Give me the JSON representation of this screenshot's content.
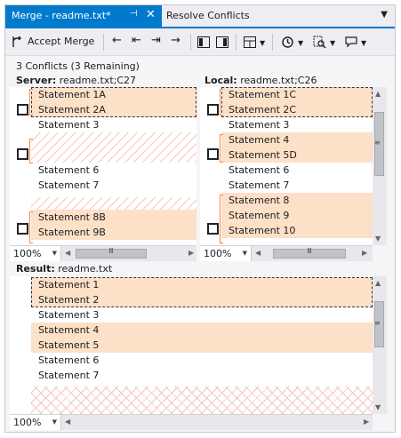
{
  "tabs": {
    "active": "Merge - readme.txt*",
    "inactive": "Resolve Conflicts"
  },
  "toolbar": {
    "accept_merge": "Accept Merge"
  },
  "status": "3 Conflicts (3 Remaining)",
  "server": {
    "label": "Server:",
    "file": "readme.txt;C27",
    "lines": [
      "Statement 1A",
      "Statement 2A",
      "Statement 3",
      "",
      "",
      "Statement 6",
      "Statement 7",
      "",
      "Statement 8B",
      "Statement 9B"
    ],
    "zoom": "100%"
  },
  "local": {
    "label": "Local:",
    "file": "readme.txt;C26",
    "lines": [
      "Statement 1C",
      "Statement 2C",
      "Statement 3",
      "Statement 4",
      "Statement 5D",
      "Statement 6",
      "Statement 7",
      "Statement 8",
      "Statement 9",
      "Statement 10"
    ],
    "zoom": "100%"
  },
  "result": {
    "label": "Result:",
    "file": "readme.txt",
    "lines": [
      "Statement 1",
      "Statement 2",
      "Statement 3",
      "Statement 4",
      "Statement 5",
      "Statement 6",
      "Statement 7"
    ],
    "zoom": "100%"
  },
  "icons": {
    "close_tab": "✕",
    "pin": "⊣",
    "dropdown": "▼",
    "prev_conflict": "←",
    "first_conflict": "⇤",
    "last_conflict": "⇥",
    "next_conflict": "→",
    "scroll_up": "▲",
    "scroll_down": "▼",
    "scroll_left": "◀",
    "scroll_right": "▶",
    "grip_v": "≡",
    "grip_h": "Ⅲ"
  },
  "colors": {
    "accent": "#007acc",
    "conflict": "#fde0c8",
    "hatch": "#f9c8b6"
  }
}
